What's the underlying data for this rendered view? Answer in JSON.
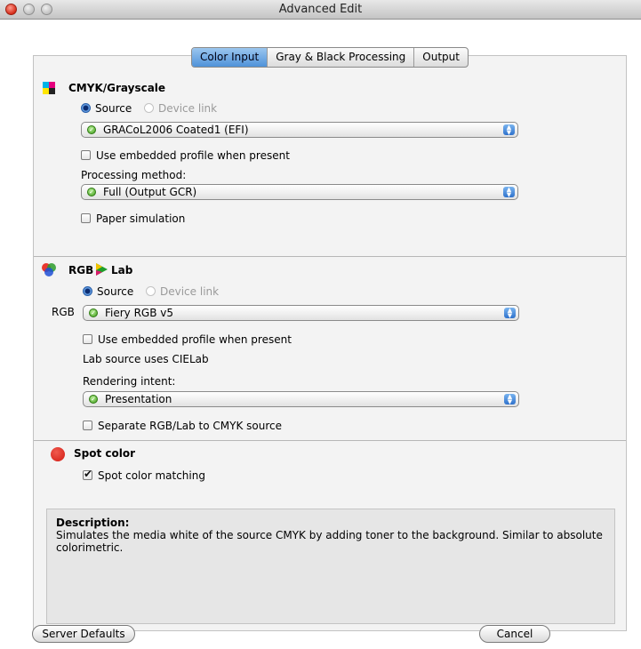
{
  "window": {
    "title": "Advanced Edit"
  },
  "tabs": [
    {
      "label": "Color Input",
      "active": true
    },
    {
      "label": "Gray & Black Processing",
      "active": false
    },
    {
      "label": "Output",
      "active": false
    }
  ],
  "cmyk": {
    "heading": "CMYK/Grayscale",
    "source_label": "Source",
    "device_link_label": "Device link",
    "profile": "GRACoL2006 Coated1 (EFI)",
    "embedded_label": "Use embedded profile when present",
    "processing_label": "Processing method:",
    "processing_value": "Full (Output GCR)",
    "paper_sim_label": "Paper simulation"
  },
  "rgb": {
    "heading_rgb": "RGB",
    "heading_lab": "Lab",
    "source_label": "Source",
    "device_link_label": "Device link",
    "row_label": "RGB",
    "profile": "Fiery RGB v5",
    "embedded_label": "Use embedded profile when present",
    "lab_note": "Lab source uses CIELab",
    "intent_label": "Rendering intent:",
    "intent_value": "Presentation",
    "separate_label": "Separate RGB/Lab to CMYK source"
  },
  "spot": {
    "heading": "Spot color",
    "matching_label": "Spot color matching",
    "matching_checked": true
  },
  "description": {
    "heading": "Description:",
    "text": "Simulates the media white of the source CMYK by adding toner to the background. Similar to absolute colorimetric."
  },
  "buttons": {
    "server_defaults": "Server Defaults",
    "cancel": "Cancel"
  }
}
